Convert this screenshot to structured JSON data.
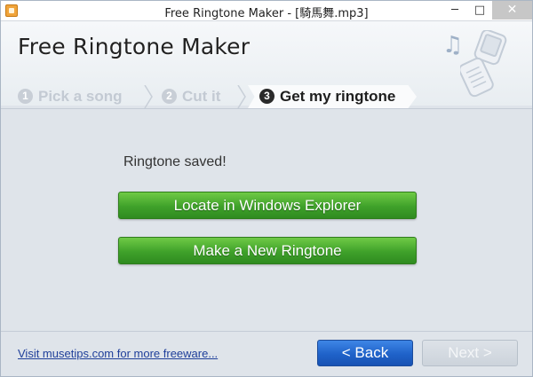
{
  "window": {
    "title": "Free Ringtone Maker - [騎馬舞.mp3]",
    "minimize": "─",
    "maximize": "□",
    "close": "✕"
  },
  "header": {
    "app_title": "Free Ringtone Maker",
    "music_note": "♫"
  },
  "steps": [
    {
      "num": "1",
      "label": "Pick a song",
      "active": false
    },
    {
      "num": "2",
      "label": "Cut it",
      "active": false
    },
    {
      "num": "3",
      "label": "Get my ringtone",
      "active": true
    }
  ],
  "main": {
    "status": "Ringtone saved!",
    "locate_button": "Locate in Windows Explorer",
    "new_button": "Make a New Ringtone"
  },
  "footer": {
    "link": "Visit musetips.com for more freeware...",
    "back_button": "< Back",
    "next_button": "Next >"
  },
  "colors": {
    "accent_green": "#3fa12a",
    "accent_blue": "#1f62c9",
    "link_blue": "#1f3f9a"
  }
}
